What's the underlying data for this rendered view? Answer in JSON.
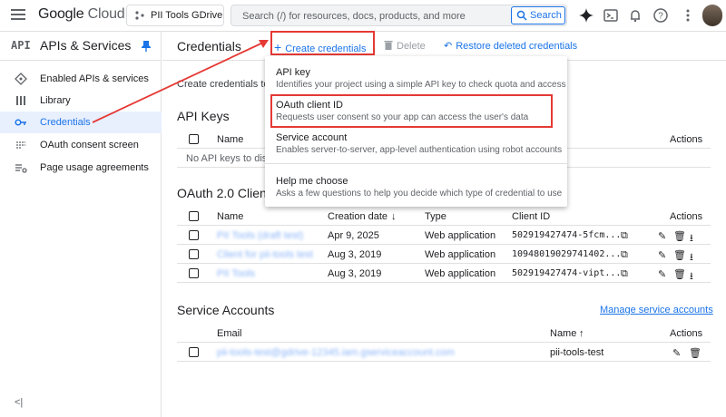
{
  "topbar": {
    "logo_google": "Google",
    "logo_cloud": "Cloud",
    "project": "PII Tools GDrive",
    "search_placeholder": "Search (/) for resources, docs, products, and more",
    "search_button": "Search"
  },
  "sidebar": {
    "badge": "API",
    "title": "APIs & Services",
    "items": [
      {
        "label": "Enabled APIs & services",
        "icon": "diamond-grid-icon"
      },
      {
        "label": "Library",
        "icon": "library-icon"
      },
      {
        "label": "Credentials",
        "icon": "key-icon"
      },
      {
        "label": "OAuth consent screen",
        "icon": "consent-icon"
      },
      {
        "label": "Page usage agreements",
        "icon": "settings-list-icon"
      }
    ],
    "collapse": "<|"
  },
  "main": {
    "title": "Credentials",
    "create": "Create credentials",
    "delete": "Delete",
    "restore": "Restore deleted credentials",
    "intro": "Create credentials to a",
    "api_keys": {
      "title": "API Keys",
      "col_name": "Name",
      "col_actions": "Actions",
      "empty": "No API keys to displ"
    },
    "oauth": {
      "title": "OAuth 2.0 Client I",
      "cols": {
        "name": "Name",
        "created": "Creation date",
        "type": "Type",
        "client_id": "Client ID",
        "actions": "Actions"
      },
      "rows": [
        {
          "name": "PII Tools (draft test)",
          "created": "Apr 9, 2025",
          "type": "Web application",
          "client_id": "502919427474-5fcm..."
        },
        {
          "name": "Client for pii-tools test",
          "created": "Aug 3, 2019",
          "type": "Web application",
          "client_id": "10948019029741402..."
        },
        {
          "name": "PII Tools",
          "created": "Aug 3, 2019",
          "type": "Web application",
          "client_id": "502919427474-vipt..."
        }
      ]
    },
    "service_accounts": {
      "title": "Service Accounts",
      "manage": "Manage service accounts",
      "col_email": "Email",
      "col_name": "Name",
      "col_actions": "Actions",
      "rows": [
        {
          "email": "pii-tools-test@gdrive-12345.iam.gserviceaccount.com",
          "name": "pii-tools-test"
        }
      ]
    }
  },
  "menu": {
    "items": [
      {
        "title": "API key",
        "desc": "Identifies your project using a simple API key to check quota and access"
      },
      {
        "title": "OAuth client ID",
        "desc": "Requests user consent so your app can access the user's data"
      },
      {
        "title": "Service account",
        "desc": "Enables server-to-server, app-level authentication using robot accounts"
      },
      {
        "title": "Help me choose",
        "desc": "Asks a few questions to help you decide which type of credential to use"
      }
    ]
  },
  "colors": {
    "accent": "#1a73e8",
    "highlight": "#e53935",
    "active_bg": "#e8f0fe"
  }
}
